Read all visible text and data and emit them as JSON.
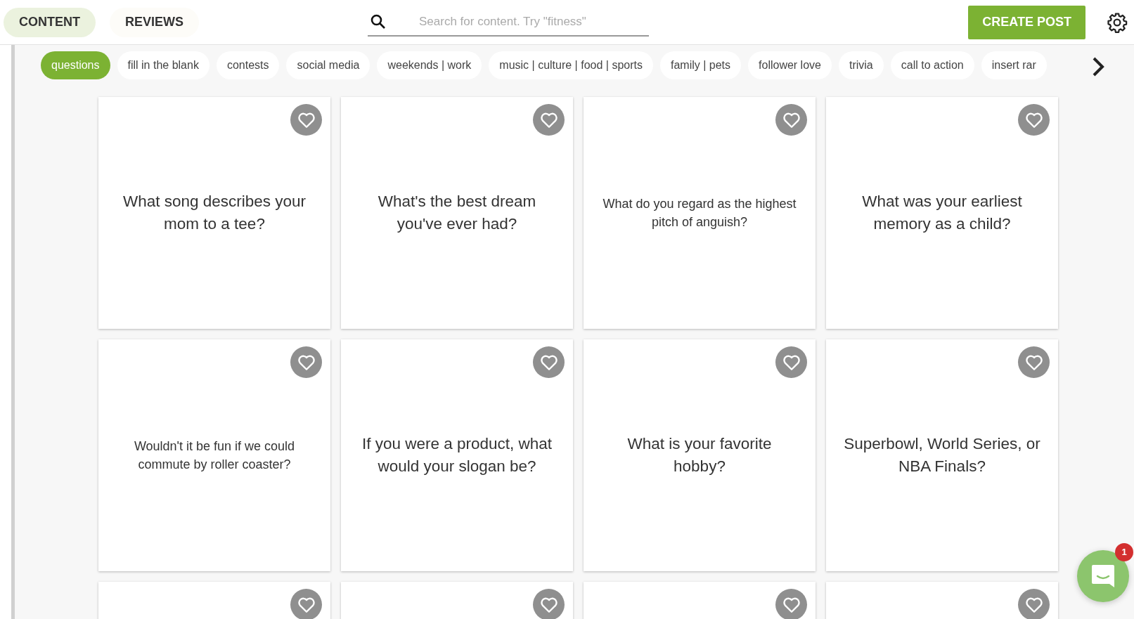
{
  "tabs": [
    {
      "label": "CONTENT",
      "selected": true
    },
    {
      "label": "REVIEWS",
      "selected": false
    }
  ],
  "search": {
    "placeholder": "Search for content. Try \"fitness\""
  },
  "create_button": "CREATE POST",
  "categories": [
    {
      "label": "questions",
      "selected": true
    },
    {
      "label": "fill in the blank",
      "selected": false
    },
    {
      "label": "contests",
      "selected": false
    },
    {
      "label": "social media",
      "selected": false
    },
    {
      "label": "weekends | work",
      "selected": false
    },
    {
      "label": "music | culture | food | sports",
      "selected": false
    },
    {
      "label": "family | pets",
      "selected": false
    },
    {
      "label": "follower love",
      "selected": false
    },
    {
      "label": "trivia",
      "selected": false
    },
    {
      "label": "call to action",
      "selected": false
    },
    {
      "label": "insert rar",
      "selected": false
    }
  ],
  "cards": [
    {
      "kind": "question",
      "text": "What song describes your mom to a tee?"
    },
    {
      "kind": "question",
      "text": "What's the best dream you've ever had?"
    },
    {
      "kind": "question",
      "text": "What do you regard as the highest pitch of anguish?"
    },
    {
      "kind": "question",
      "text": "What was your earliest memory as a child?"
    },
    {
      "kind": "question",
      "text": "Wouldn't it be fun if we could commute by roller coaster?"
    },
    {
      "kind": "question",
      "text": "If you were a product, what would your slogan be?"
    },
    {
      "kind": "question",
      "text": "What is your favorite hobby?"
    },
    {
      "kind": "question",
      "text": "Superbowl, World Series, or NBA Finals?"
    },
    {
      "kind": "partial"
    },
    {
      "kind": "partial"
    },
    {
      "kind": "partial"
    },
    {
      "kind": "partial"
    }
  ],
  "chat": {
    "badge": "1"
  }
}
